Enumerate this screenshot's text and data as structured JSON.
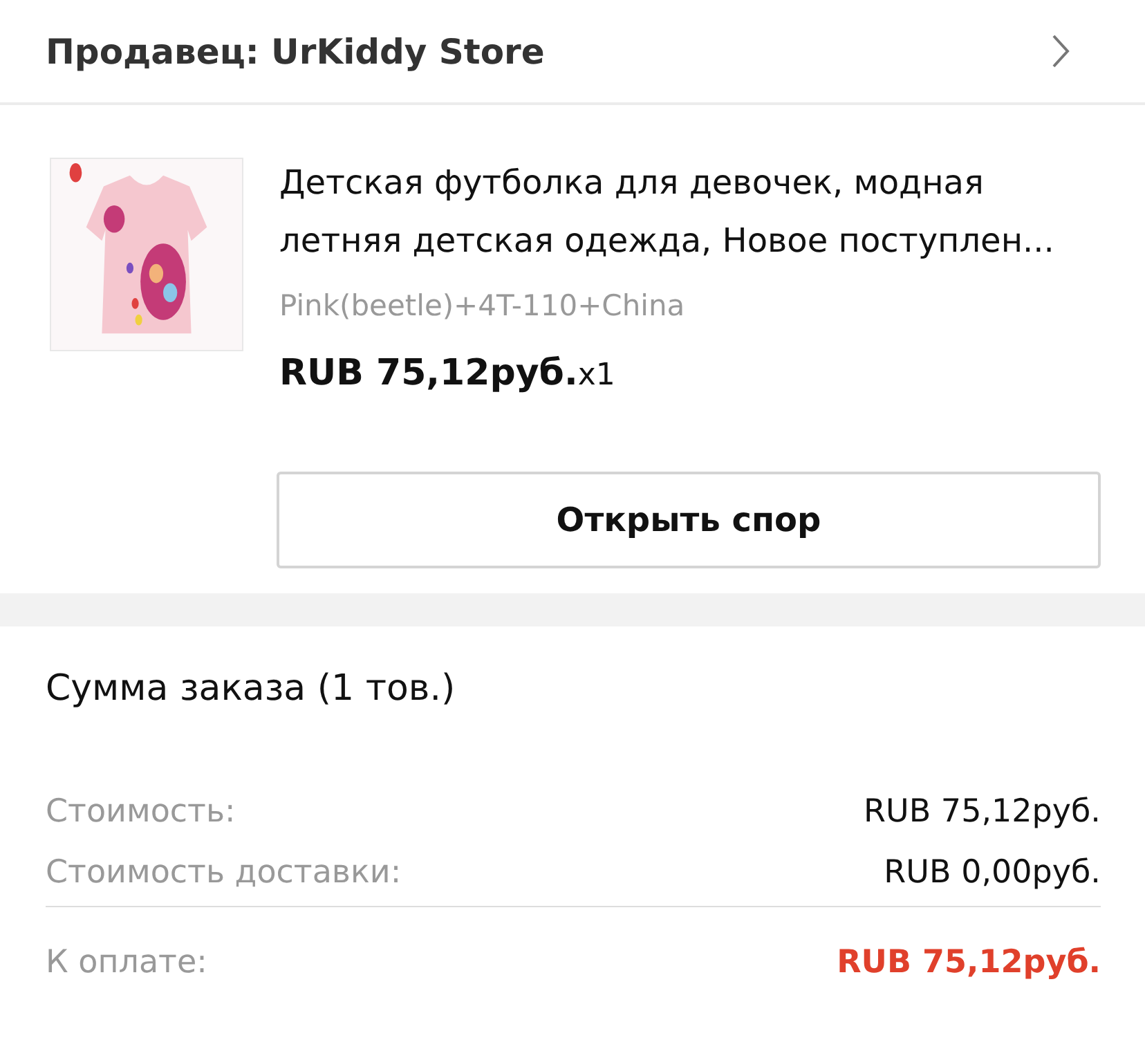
{
  "seller": {
    "label": "Продавец: UrKiddy Store"
  },
  "product": {
    "title": "Детская футболка для девочек, модная летняя детская одежда, Новое поступлен...",
    "variant": "Pink(beetle)+4T-110+China",
    "price": "RUB 75,12руб.",
    "quantity": "x1"
  },
  "dispute_button": "Открыть спор",
  "summary": {
    "title": "Сумма заказа (1 тов.)",
    "rows": [
      {
        "kind": "line",
        "label": "Стоимость:",
        "value": "RUB 75,12руб."
      },
      {
        "kind": "line",
        "label": "Стоимость доставки:",
        "value": "RUB 0,00руб."
      },
      {
        "kind": "total",
        "label": "К оплате:",
        "value": "RUB 75,12руб."
      }
    ]
  }
}
